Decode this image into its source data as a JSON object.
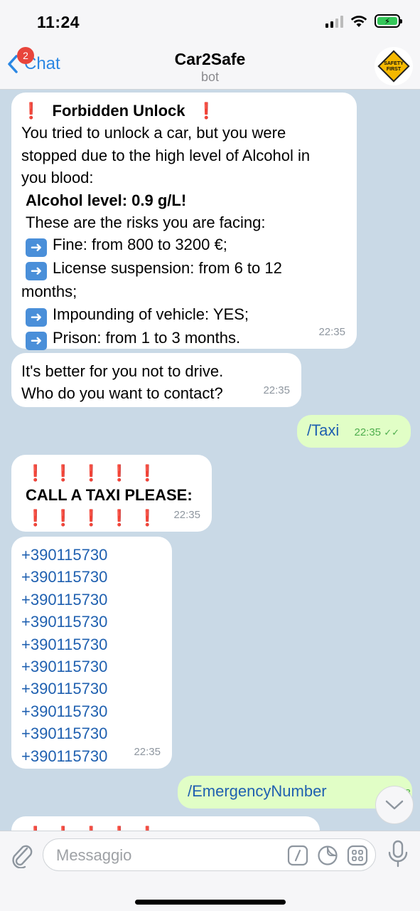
{
  "status": {
    "time": "11:24",
    "battery_label": "⚡"
  },
  "header": {
    "back_label": "Chat",
    "unread_badge": "2",
    "title": "Car2Safe",
    "subtitle": "bot",
    "avatar_text_1": "SAFETY",
    "avatar_text_2": "FIRST"
  },
  "messages": {
    "m1": {
      "title": "Forbidden Unlock",
      "line1": "You tried to unlock a car, but you were",
      "line2": "stopped due to the high level of Alcohol in",
      "line3": "you blood:",
      "alcohol": "Alcohol level: 0.9 g/L!",
      "risks_intro": "These are the risks you are facing:",
      "risk1": "Fine: from 800 to 3200 €;",
      "risk2a": "License suspension: from 6 to 12",
      "risk2b": "months;",
      "risk3": "Impounding of vehicle: YES;",
      "risk4": "Prison: from 1 to 3 months.",
      "time": "22:35"
    },
    "m2": {
      "line1": "It's better for you not to drive.",
      "line2": "Who do you want to contact?",
      "time": "22:35"
    },
    "m3": {
      "text": "/Taxi",
      "time": "22:35",
      "ticks": "✓✓"
    },
    "m4": {
      "text": "CALL A TAXI PLEASE:",
      "time": "22:35"
    },
    "m5": {
      "numbers": [
        "+390115730",
        "+390115730",
        "+390115730",
        "+390115730",
        "+390115730",
        "+390115730",
        "+390115730",
        "+390115730",
        "+390115730",
        "+390115730"
      ],
      "time": "22:35"
    },
    "m6": {
      "text": "/EmergencyNumber",
      "time": "22:3"
    }
  },
  "input": {
    "placeholder": "Messaggio"
  },
  "colors": {
    "accent": "#2b87e3",
    "outgoing": "#e1fec6",
    "exclamation": "#e0202e",
    "chat_bg": "#c9d9e6"
  }
}
